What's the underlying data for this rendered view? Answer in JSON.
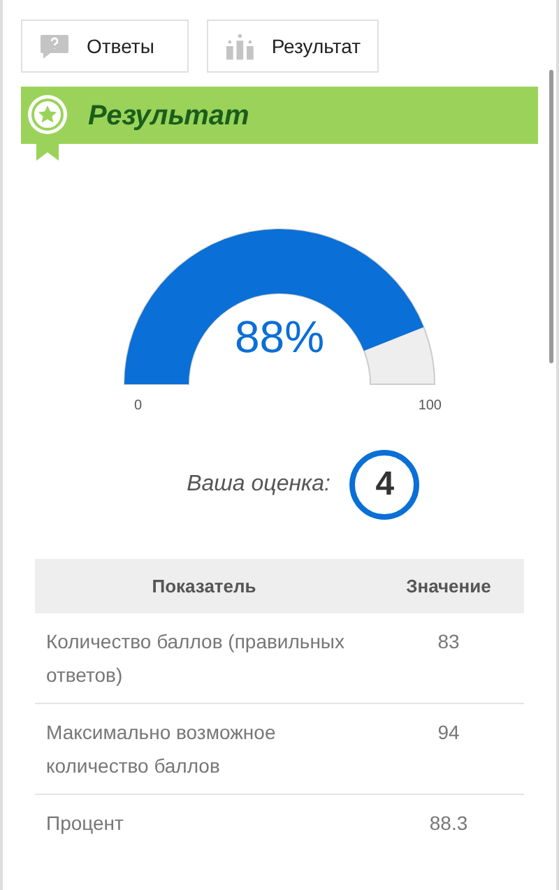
{
  "tabs": [
    {
      "label": "Ответы",
      "selected": false
    },
    {
      "label": "Результат",
      "selected": false
    }
  ],
  "header": {
    "title": "Результат"
  },
  "gauge": {
    "value_text": "88%",
    "min_label": "0",
    "max_label": "100"
  },
  "grade": {
    "label": "Ваша оценка:",
    "value": "4"
  },
  "table": {
    "columns": [
      "Показатель",
      "Значение"
    ],
    "rows": [
      [
        "Количество баллов (правильных ответов)",
        "83"
      ],
      [
        "Максимально возможное количество баллов",
        "94"
      ],
      [
        "Процент",
        "88.3"
      ]
    ]
  }
}
